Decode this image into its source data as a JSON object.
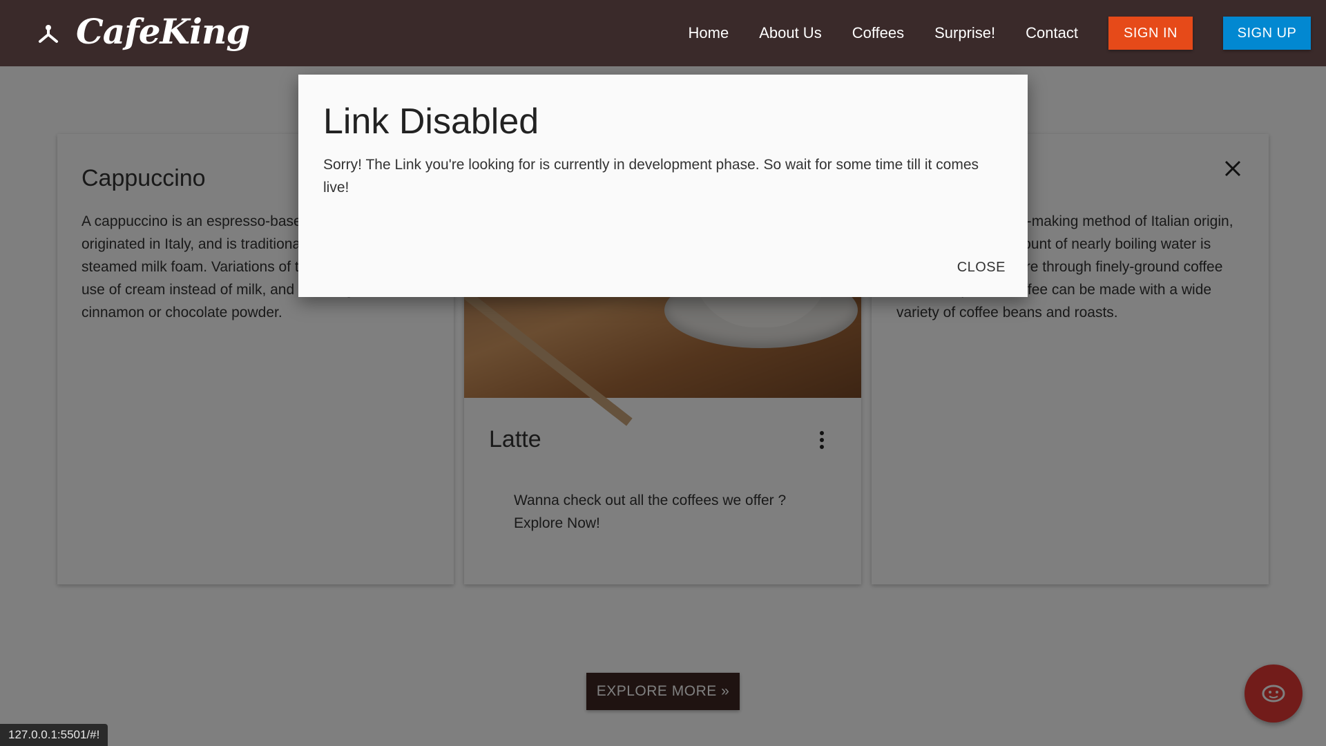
{
  "navbar": {
    "brand": "CafeKing",
    "links": [
      "Home",
      "About Us",
      "Coffees",
      "Surprise!",
      "Contact"
    ],
    "signin_label": "SIGN IN",
    "signup_label": "SIGN UP"
  },
  "cards": {
    "cappuccino": {
      "title": "Cappuccino",
      "text": "A cappuccino is an espresso-based coffee drink that originated in Italy, and is traditionally prepared with steamed milk foam. Variations of the drink involve the use of cream instead of milk, and flavoring with cinnamon or chocolate powder."
    },
    "latte": {
      "title": "Latte",
      "text": "Wanna check out all the coffees we offer ? Explore Now!"
    },
    "espresso": {
      "text": "Espresso is a coffee-making method of Italian origin, in which a small amount of nearly boiling water is forced under pressure through finely-ground coffee beans. Espresso coffee can be made with a wide variety of coffee beans and roasts."
    }
  },
  "explore_label": "EXPLORE MORE »",
  "status_url": "127.0.0.1:5501/#!",
  "modal": {
    "title": "Link Disabled",
    "text": "Sorry! The Link you're looking for is currently in development phase. So wait for some time till it comes live!",
    "close_label": "CLOSE"
  },
  "colors": {
    "navbar": "#3a2a2a",
    "signin": "#e64a19",
    "signup": "#0288d1",
    "explore": "#3e2723",
    "fab": "#e53935"
  },
  "icons": {
    "brand": "coffee-fork-icon",
    "card_more": "more-vert-icon",
    "card_close": "close-icon",
    "fab": "eye-face-icon"
  }
}
